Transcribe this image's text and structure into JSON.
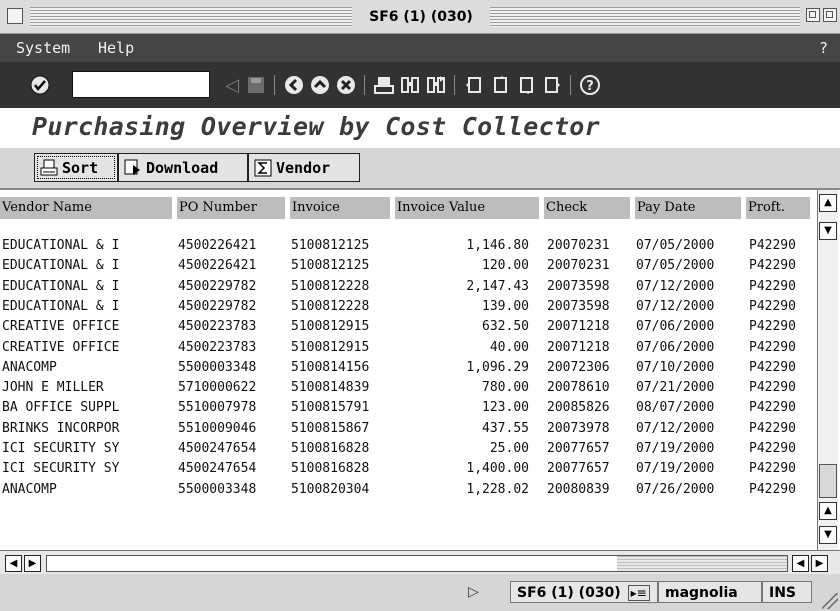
{
  "window": {
    "title": "SF6 (1) (030)"
  },
  "menu": {
    "items": [
      "System",
      "Help"
    ],
    "help_icon": "?"
  },
  "toolbar": {
    "icons": [
      "enter-icon",
      "back-arrow-icon",
      "save-icon",
      "back-icon",
      "exit-icon",
      "cancel-icon",
      "print-icon",
      "find-icon",
      "find-next-icon",
      "first-page-icon",
      "previous-page-icon",
      "next-page-icon",
      "last-page-icon",
      "help-icon"
    ],
    "command_field_value": ""
  },
  "page": {
    "title": "Purchasing Overview by Cost Collector"
  },
  "app_toolbar": {
    "sort_label": "Sort",
    "download_label": "Download",
    "vendor_label": "Vendor"
  },
  "table": {
    "headers": [
      "Vendor Name",
      "PO Number",
      "Invoice",
      "Invoice Value",
      "Check",
      "Pay Date",
      "Proft."
    ],
    "rows": [
      [
        "EDUCATIONAL & I",
        "4500226421",
        "5100812125",
        "1,146.80",
        "20070231",
        "07/05/2000",
        "P42290"
      ],
      [
        "EDUCATIONAL & I",
        "4500226421",
        "5100812125",
        "120.00",
        "20070231",
        "07/05/2000",
        "P42290"
      ],
      [
        "EDUCATIONAL & I",
        "4500229782",
        "5100812228",
        "2,147.43",
        "20073598",
        "07/12/2000",
        "P42290"
      ],
      [
        "EDUCATIONAL & I",
        "4500229782",
        "5100812228",
        "139.00",
        "20073598",
        "07/12/2000",
        "P42290"
      ],
      [
        "CREATIVE OFFICE",
        "4500223783",
        "5100812915",
        "632.50",
        "20071218",
        "07/06/2000",
        "P42290"
      ],
      [
        "CREATIVE OFFICE",
        "4500223783",
        "5100812915",
        "40.00",
        "20071218",
        "07/06/2000",
        "P42290"
      ],
      [
        "ANACOMP",
        "5500003348",
        "5100814156",
        "1,096.29",
        "20072306",
        "07/10/2000",
        "P42290"
      ],
      [
        "JOHN E MILLER",
        "5710000622",
        "5100814839",
        "780.00",
        "20078610",
        "07/21/2000",
        "P42290"
      ],
      [
        "BA OFFICE SUPPL",
        "5510007978",
        "5100815791",
        "123.00",
        "20085826",
        "08/07/2000",
        "P42290"
      ],
      [
        "BRINKS INCORPOR",
        "5510009046",
        "5100815867",
        "437.55",
        "20073978",
        "07/12/2000",
        "P42290"
      ],
      [
        "ICI SECURITY SY",
        "4500247654",
        "5100816828",
        "25.00",
        "20077657",
        "07/19/2000",
        "P42290"
      ],
      [
        "ICI SECURITY SY",
        "4500247654",
        "5100816828",
        "1,400.00",
        "20077657",
        "07/19/2000",
        "P42290"
      ],
      [
        "ANACOMP",
        "5500003348",
        "5100820304",
        "1,228.02",
        "20080839",
        "07/26/2000",
        "P42290"
      ]
    ]
  },
  "status": {
    "system": "SF6 (1) (030)",
    "server": "magnolia",
    "mode": "INS"
  }
}
